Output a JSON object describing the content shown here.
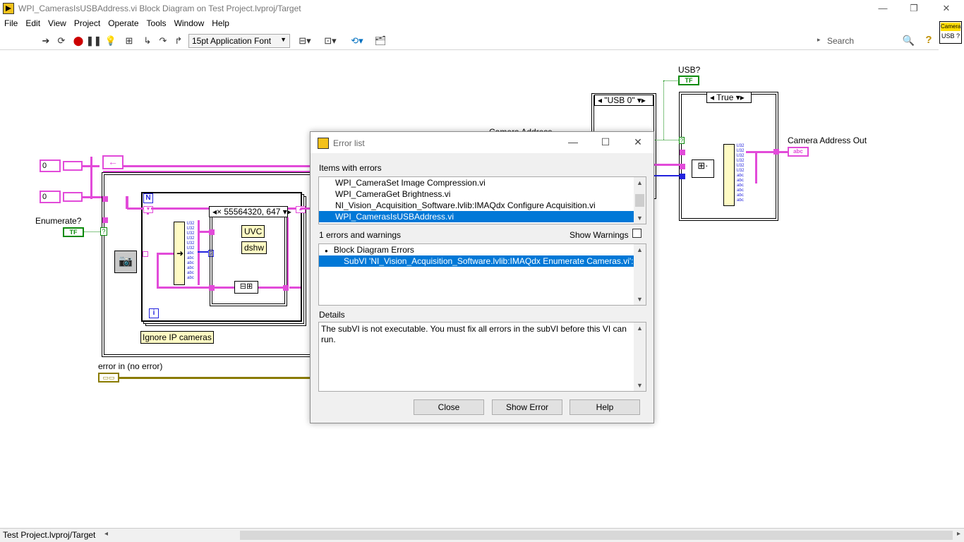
{
  "window": {
    "title": "WPI_CamerasIsUSBAddress.vi Block Diagram on Test Project.lvproj/Target",
    "minimize": "—",
    "restore": "❐",
    "close": "✕"
  },
  "menu": [
    "File",
    "Edit",
    "View",
    "Project",
    "Operate",
    "Tools",
    "Window",
    "Help"
  ],
  "toolbar": {
    "font": "15pt Application Font",
    "search_placeholder": "Search",
    "help": "?"
  },
  "vi_icon": {
    "line1": "Camera",
    "line2": "USB ?"
  },
  "diagram": {
    "const_zero_1": "0",
    "const_zero_2": "0",
    "enumerate_label": "Enumerate?",
    "bool_tf": "TF",
    "for_loop_n": "N",
    "for_loop_i": "i",
    "case_selector": "55564320, 647",
    "uvc": "UVC",
    "dshw": "dshw",
    "ignore_ip": "Ignore IP cameras",
    "error_in_label": "error in (no error)",
    "usb_label": "USB?",
    "usb0_selector": "\"USB 0\"",
    "true_selector": "True",
    "camera_addr_out": "Camera Address Out",
    "camera_addr_partial": "Camera Address",
    "q_mark": "?",
    "str_ind": "abc"
  },
  "status": {
    "target": "Test Project.lvproj/Target"
  },
  "dialog": {
    "title": "Error list",
    "items_with_errors_label": "Items with errors",
    "items": [
      "WPI_CameraSet Image Compression.vi",
      "WPI_CameraGet Brightness.vi",
      "NI_Vision_Acquisition_Software.lvlib:IMAQdx Configure Acquisition.vi",
      "WPI_CamerasIsUSBAddress.vi"
    ],
    "selected_item_index": 3,
    "errors_count_label": "1 errors and warnings",
    "show_warnings_label": "Show Warnings",
    "errors_group": "Block Diagram Errors",
    "error_detail_row": "SubVI 'NI_Vision_Acquisition_Software.lvlib:IMAQdx Enumerate Cameras.vi': Su",
    "details_label": "Details",
    "details_text": "The subVI is not executable. You must fix all errors in the subVI before this VI can run.",
    "buttons": {
      "close": "Close",
      "show_error": "Show Error",
      "help": "Help"
    }
  }
}
